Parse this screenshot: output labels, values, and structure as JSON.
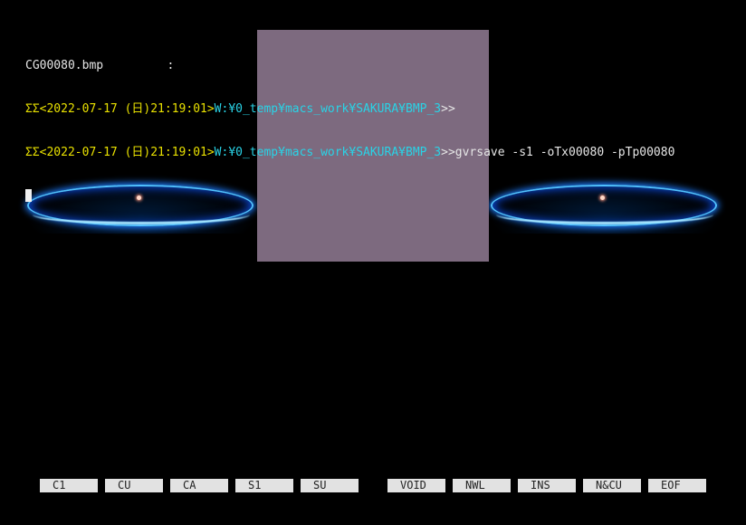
{
  "console": {
    "line1": {
      "filename": "CG00080.bmp",
      "trailing": "         :"
    },
    "line2": {
      "prompt_sigil": "ΣΣ",
      "datetime": "<2022-07-17 (日)21:19:01>",
      "path": "W:¥0_temp¥macs_work¥SAKURA¥BMP_3",
      "suffix": ">>"
    },
    "line3": {
      "prompt_sigil": "ΣΣ",
      "datetime": "<2022-07-17 (日)21:19:01>",
      "path": "W:¥0_temp¥macs_work¥SAKURA¥BMP_3",
      "suffix": ">>",
      "command": "gvrsave -s1 -oTx00080 -pTp00080"
    }
  },
  "colors": {
    "background": "#000000",
    "text": "#e6e6e6",
    "prompt_yellow": "#e8e000",
    "path_cyan": "#29d3e6",
    "overlay": "#7d6a7f",
    "ring_blue": "#4fc0ff",
    "function_key_bg": "#e2e2e2"
  },
  "function_keys": [
    {
      "label": "C1"
    },
    {
      "label": "CU"
    },
    {
      "label": "CA"
    },
    {
      "label": "S1"
    },
    {
      "label": "SU"
    },
    {
      "label": "VOID"
    },
    {
      "label": "NWL"
    },
    {
      "label": "INS"
    },
    {
      "label": "N&CU"
    },
    {
      "label": "EOF"
    }
  ]
}
